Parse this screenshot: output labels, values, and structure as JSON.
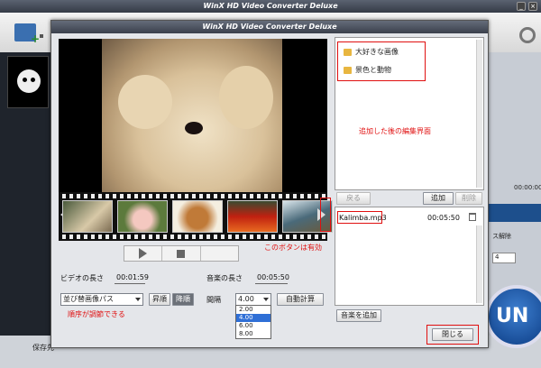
{
  "app": {
    "title": "WinX HD Video Converter Deluxe",
    "win_btns": [
      "_",
      "×"
    ]
  },
  "background": {
    "time_readout": "00:00:00",
    "output_label": "保存先",
    "deinterlace_label": "ス解除",
    "select_value": "4",
    "run_label": "UN"
  },
  "dialog": {
    "title": "WinX HD Video Converter Deluxe",
    "video_length_label": "ビデオの長さ",
    "video_length_value": "00:01:59",
    "music_length_label": "音楽の長さ",
    "music_length_value": "00:05:50",
    "sort_select_value": "並び替画像パス",
    "asc_button": "昇順",
    "desc_button": "降順",
    "interval_label": "間隔",
    "interval_value": "4.00",
    "interval_options": [
      "2.00",
      "4.00",
      "6.00",
      "8.00"
    ],
    "interval_selected_index": 1,
    "auto_calc_button": "自動計算",
    "annotation_sort": "順序が調節できる",
    "annotation_button_valid": "このボタンは有効",
    "annotation_edit_screen": "追加した後の編集界面",
    "image_list": [
      {
        "name": "大好きな画像"
      },
      {
        "name": "景色と動物"
      }
    ],
    "back_button": "戻る",
    "add_button": "追加",
    "delete_button": "削除",
    "music_list": [
      {
        "name": "Kalimba.mp3",
        "duration": "00:05:50"
      }
    ],
    "add_music_button": "音楽を追加",
    "close_button": "閉じる"
  },
  "colors": {
    "annotation": "#e01010",
    "dialog_bg": "#e4e6ea",
    "run_button": "#1b5ab0"
  }
}
